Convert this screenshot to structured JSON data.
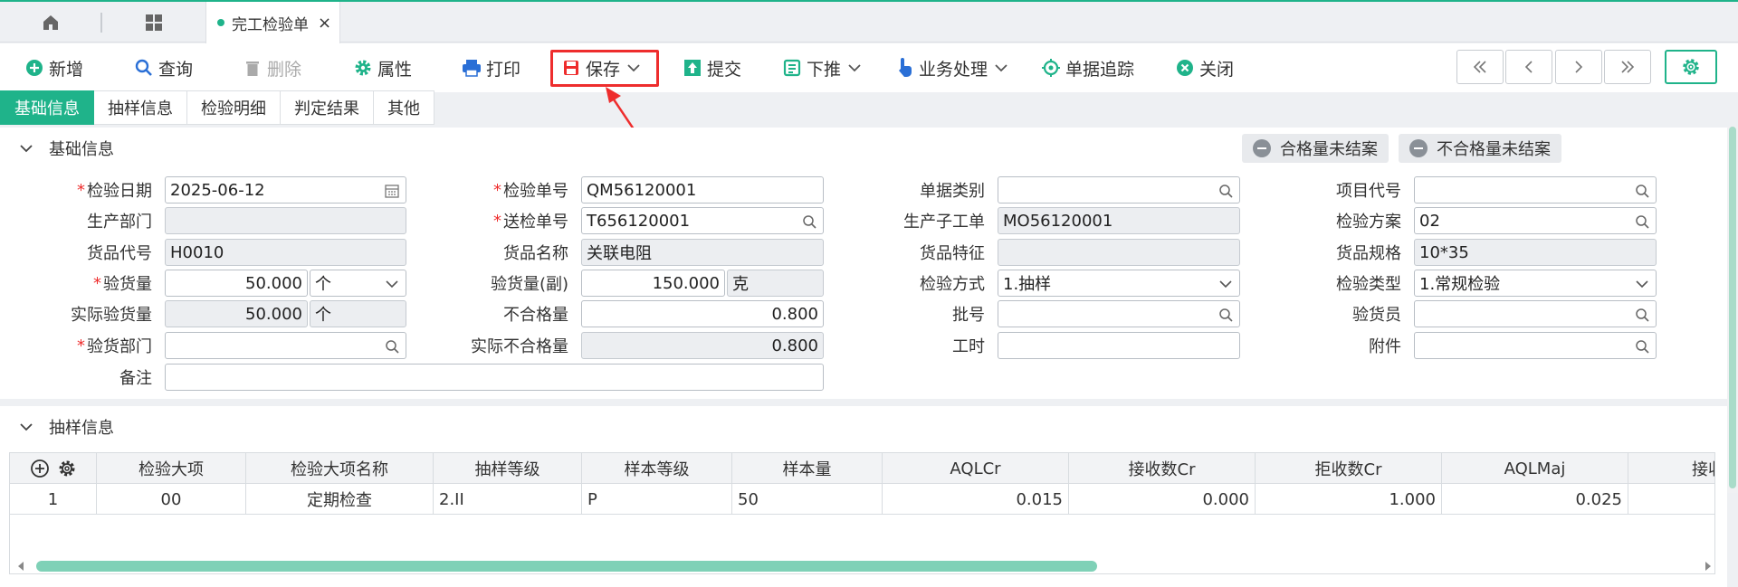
{
  "tabs": {
    "active_label": "完工检验单",
    "close": "×"
  },
  "toolbar": {
    "add": "新增",
    "query": "查询",
    "delete": "删除",
    "props": "属性",
    "print": "打印",
    "save": "保存",
    "submit": "提交",
    "push": "下推",
    "business": "业务处理",
    "trace": "单据追踪",
    "close": "关闭"
  },
  "subtabs": [
    "基础信息",
    "抽样信息",
    "检验明细",
    "判定结果",
    "其他"
  ],
  "basic": {
    "title": "基础信息",
    "btn_qualified": "合格量未结案",
    "btn_unqualified": "不合格量未结案",
    "labels": {
      "inspect_date": "检验日期",
      "inspect_no": "检验单号",
      "doc_type": "单据类别",
      "item_code": "项目代号",
      "prod_dept": "生产部门",
      "submit_no": "送检单号",
      "sub_order": "生产子工单",
      "plan": "检验方案",
      "goods_code": "货品代号",
      "goods_name": "货品名称",
      "goods_feature": "货品特征",
      "goods_spec": "货品规格",
      "qty": "验货量",
      "qty_sub": "验货量(副)",
      "method": "检验方式",
      "inspect_type": "检验类型",
      "actual_qty": "实际验货量",
      "unqualified": "不合格量",
      "batch": "批号",
      "inspector": "验货员",
      "inspect_dept": "验货部门",
      "actual_unqualified": "实际不合格量",
      "hours": "工时",
      "attachment": "附件",
      "remark": "备注"
    },
    "values": {
      "inspect_date": "2025-06-12",
      "inspect_no": "QM56120001",
      "doc_type": "",
      "item_code": "",
      "prod_dept": "",
      "submit_no": "T656120001",
      "sub_order": "MO56120001",
      "plan": "02",
      "goods_code": "H0010",
      "goods_name": "关联电阻",
      "goods_feature": "",
      "goods_spec": "10*35",
      "qty": "50.000",
      "qty_unit": "个",
      "qty_sub": "150.000",
      "qty_sub_unit": "克",
      "method": "1.抽样",
      "inspect_type": "1.常规检验",
      "actual_qty": "50.000",
      "actual_qty_unit": "个",
      "unqualified": "0.800",
      "batch": "",
      "inspector": "",
      "inspect_dept": "",
      "actual_unqualified": "0.800",
      "hours": "",
      "attachment": "",
      "remark": ""
    }
  },
  "sampling": {
    "title": "抽样信息",
    "columns": [
      "检验大项",
      "检验大项名称",
      "抽样等级",
      "样本等级",
      "样本量",
      "AQLCr",
      "接收数Cr",
      "拒收数Cr",
      "AQLMaj",
      "接收"
    ],
    "rows": [
      {
        "no": "1",
        "item": "00",
        "name": "定期检查",
        "level": "2.II",
        "sample_level": "P",
        "size": "50",
        "aqlcr": "0.015",
        "acc_cr": "0.000",
        "rej_cr": "1.000",
        "aqlmaj": "0.025"
      }
    ]
  },
  "colors": {
    "accent": "#1fb38a",
    "highlight": "#ee2d2d"
  }
}
